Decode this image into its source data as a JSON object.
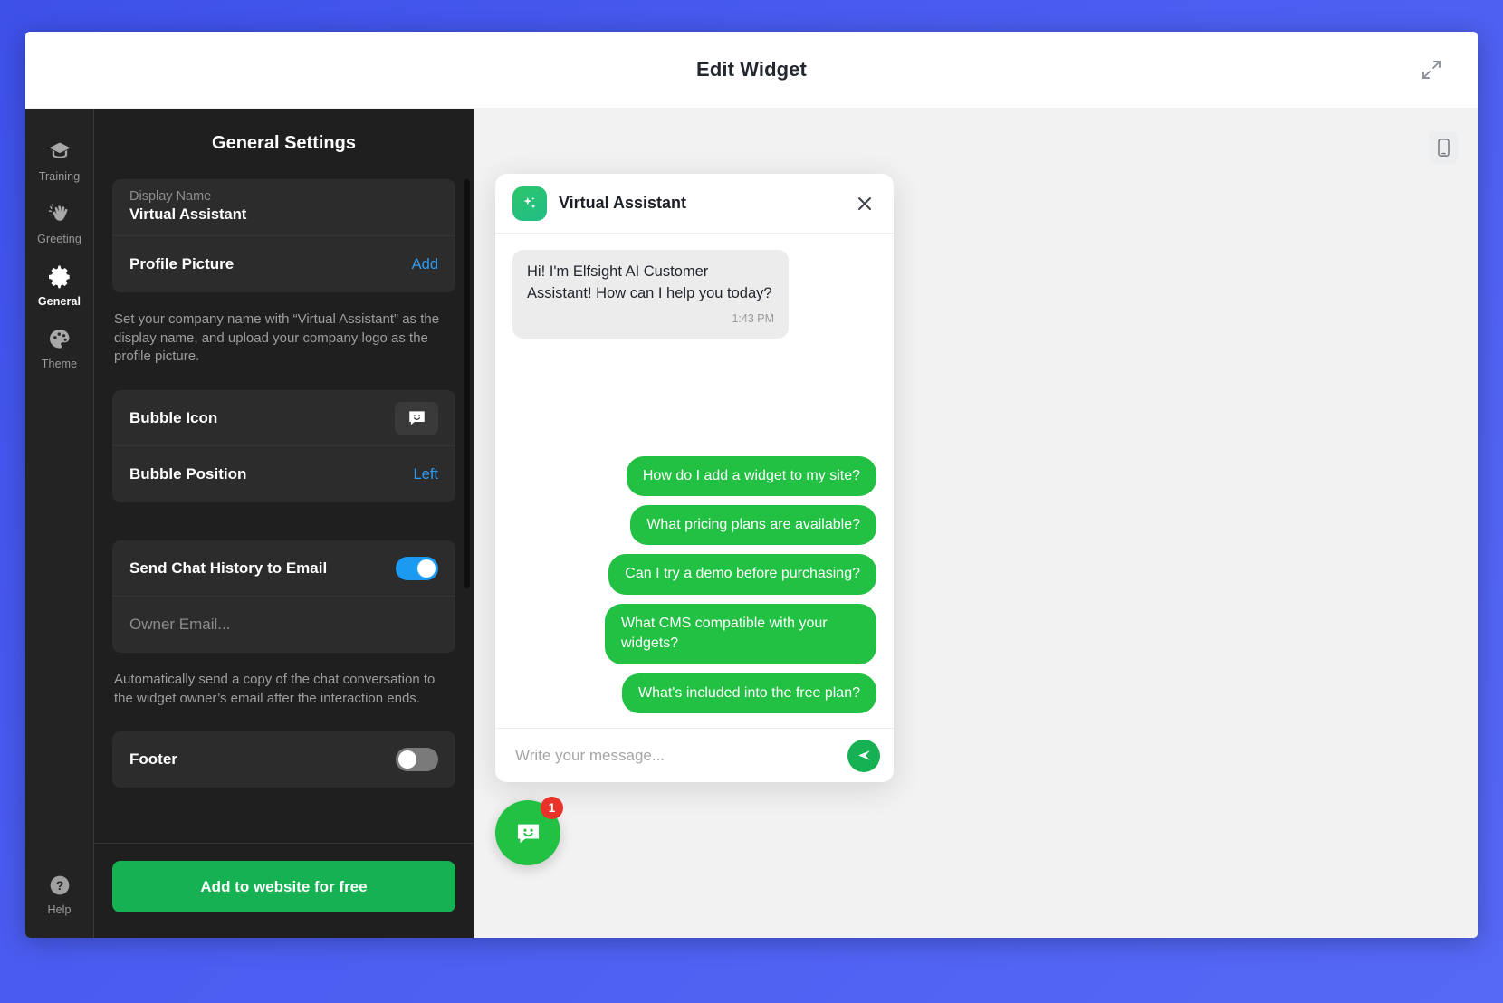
{
  "window": {
    "title": "Edit Widget",
    "expand_icon": "expand-arrows-icon"
  },
  "rail": {
    "items": [
      {
        "label": "Training",
        "icon": "graduation-cap-icon",
        "active": false
      },
      {
        "label": "Greeting",
        "icon": "waving-hand-icon",
        "active": false
      },
      {
        "label": "General",
        "icon": "gear-icon",
        "active": true
      },
      {
        "label": "Theme",
        "icon": "palette-icon",
        "active": false
      }
    ],
    "bottom": {
      "label": "Help",
      "icon": "question-mark-circle-icon"
    }
  },
  "settings": {
    "title": "General Settings",
    "display_name": {
      "label": "Display Name",
      "value": "Virtual Assistant"
    },
    "profile_picture": {
      "label": "Profile Picture",
      "action": "Add"
    },
    "hint_1": "Set your company name with “Virtual Assistant” as the display name, and upload your company logo as the profile picture.",
    "bubble_icon": {
      "label": "Bubble Icon",
      "icon": "chat-bubble-smiley-icon"
    },
    "bubble_position": {
      "label": "Bubble Position",
      "value": "Left"
    },
    "send_chat_history": {
      "label": "Send Chat History to Email",
      "state": "on"
    },
    "owner_email": {
      "placeholder": "Owner Email..."
    },
    "hint_2": "Automatically send a copy of the chat conversation to the widget owner’s email after the interaction ends.",
    "footer_toggle": {
      "label": "Footer",
      "state": "off"
    },
    "cta_label": "Add to website for free"
  },
  "preview": {
    "device_toggle_icon": "mobile-phone-icon",
    "widget": {
      "header": {
        "avatar_icon": "sparkles-icon",
        "title": "Virtual Assistant",
        "close_icon": "close-icon"
      },
      "messages": [
        {
          "from": "bot",
          "text": "Hi! I'm Elfsight AI Customer Assistant! How can I help you today?",
          "time": "1:43 PM"
        }
      ],
      "quick_replies": [
        "How do I add a widget to my site?",
        "What pricing plans are available?",
        "Can I try a demo before purchasing?",
        "What CMS compatible with your widgets?",
        "What's included into the free plan?"
      ],
      "input": {
        "placeholder": "Write your message...",
        "value": "",
        "send_icon": "send-paper-plane-icon"
      }
    },
    "launcher": {
      "icon": "chat-bubble-smiley-icon",
      "badge": "1"
    }
  },
  "colors": {
    "brand_green": "#22c043",
    "cta_green": "#16b152",
    "accent_blue": "#2f9bf2",
    "toggle_on": "#1a9af0",
    "badge_red": "#e8322a",
    "page_background": "#4a5cf0"
  }
}
